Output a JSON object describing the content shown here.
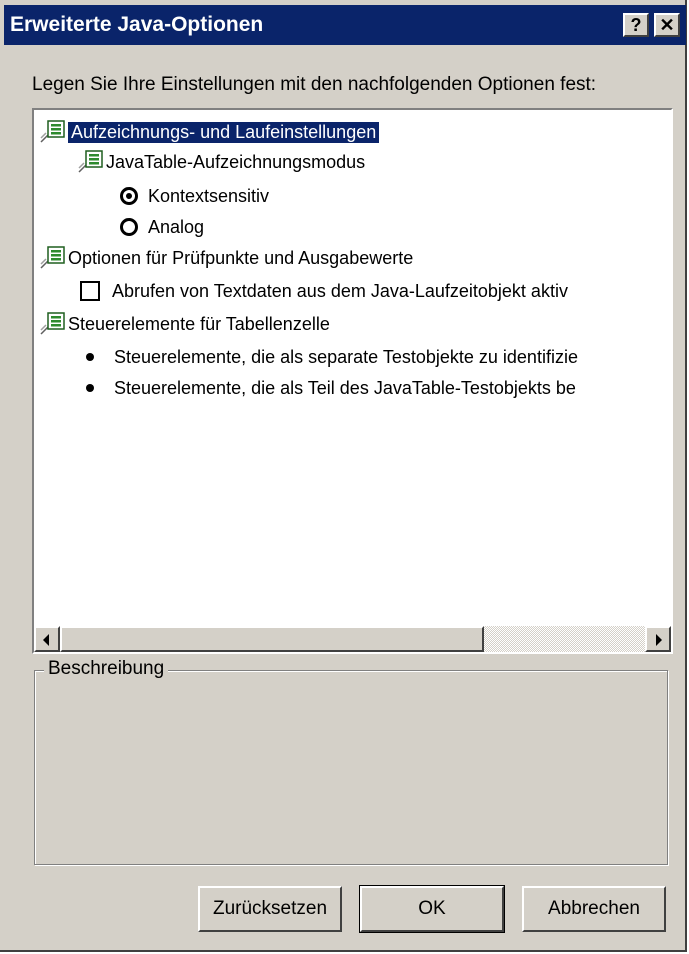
{
  "window": {
    "title": "Erweiterte Java-Optionen",
    "help_button": "?",
    "close_button": "✕"
  },
  "instruction": "Legen Sie Ihre Einstellungen mit den nachfolgenden Optionen fest:",
  "tree": {
    "group1": {
      "label": "Aufzeichnungs- und Laufeinstellungen",
      "selected": true,
      "child": {
        "label": "JavaTable-Aufzeichnungsmodus",
        "options": [
          {
            "label": "Kontextsensitiv",
            "checked": true
          },
          {
            "label": "Analog",
            "checked": false
          }
        ]
      }
    },
    "group2": {
      "label": "Optionen für Prüfpunkte und Ausgabewerte",
      "checkbox": {
        "label": "Abrufen von Textdaten aus dem Java-Laufzeitobjekt aktiv",
        "checked": false
      }
    },
    "group3": {
      "label": "Steuerelemente für Tabellenzelle",
      "items": [
        "Steuerelemente, die als separate Testobjekte zu identifizie",
        "Steuerelemente, die als Teil des JavaTable-Testobjekts be"
      ]
    }
  },
  "description": {
    "legend": "Beschreibung"
  },
  "buttons": {
    "reset": "Zurücksetzen",
    "ok": "OK",
    "cancel": "Abbrechen"
  },
  "colors": {
    "titlebar": "#0a246a",
    "dialog_bg": "#d4d0c8",
    "selection": "#0a246a",
    "icon_green": "#2e8b2e"
  },
  "icons": {
    "tree_node": "options-node-icon",
    "help": "help-icon",
    "close": "close-icon"
  }
}
